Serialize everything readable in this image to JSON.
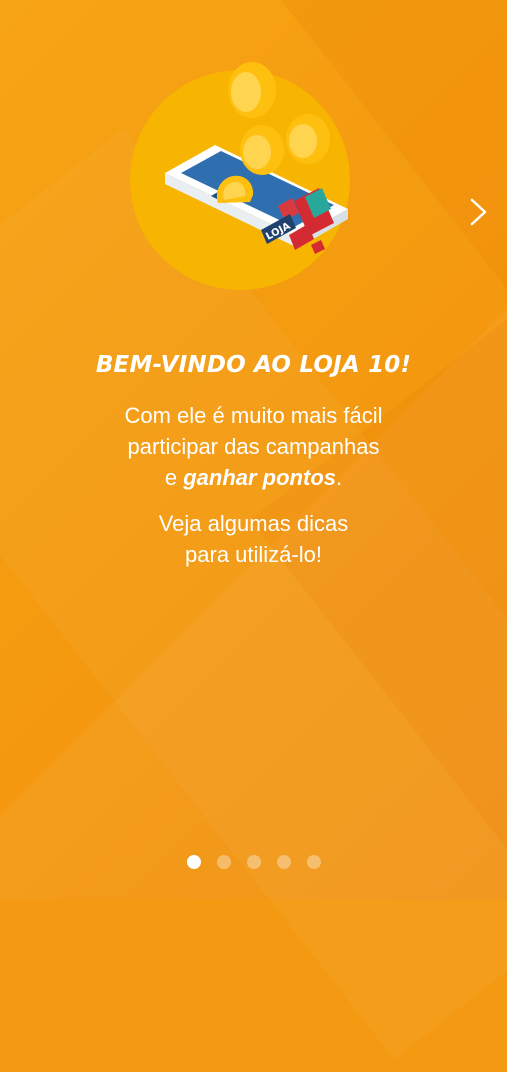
{
  "title": "BEM-VINDO AO LOJA 10!",
  "description": {
    "line1": "Com ele é muito mais fácil",
    "line2": "participar das campanhas",
    "line3_prefix": "e ",
    "line3_emphasis": "ganhar pontos",
    "line3_suffix": "."
  },
  "tip": {
    "line1": "Veja algumas dicas",
    "line2": "para utilizá-lo!"
  },
  "illustration": {
    "badge_text": "LOJA",
    "colors": {
      "circle": "#f7b500",
      "phone": "#ffffff",
      "screen": "#2c6fb2",
      "coin": "#ffc20e",
      "accent_red": "#d42b33",
      "accent_teal": "#27b6a6"
    }
  },
  "navigation": {
    "next_icon": "chevron-right-icon",
    "total_pages": 5,
    "current_page": 1
  }
}
